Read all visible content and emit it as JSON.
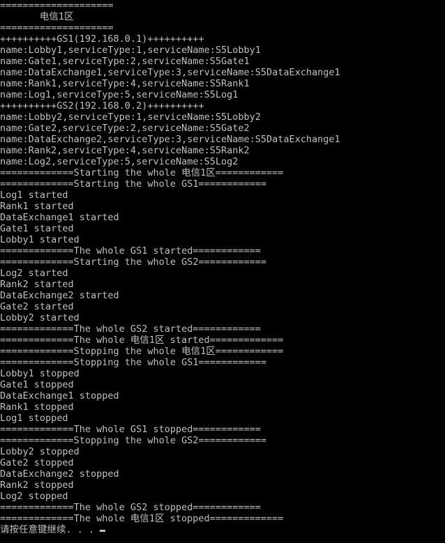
{
  "window": {
    "type": "console",
    "background_color": "#000000",
    "text_color": "#c0c0c0",
    "columns": 80,
    "rows": 48
  },
  "console": {
    "lines": [
      "====================",
      "       电信1区",
      "====================",
      "++++++++++GS1(192.168.0.1)++++++++++",
      "name:Lobby1,serviceType:1,serviceName:S5Lobby1",
      "name:Gate1,serviceType:2,serviceName:S5Gate1",
      "name:DataExchange1,serviceType:3,serviceName:S5DataExchange1",
      "name:Rank1,serviceType:4,serviceName:S5Rank1",
      "name:Log1,serviceType:5,serviceName:S5Log1",
      "++++++++++GS2(192.168.0.2)++++++++++",
      "name:Lobby2,serviceType:1,serviceName:S5Lobby2",
      "name:Gate2,serviceType:2,serviceName:S5Gate2",
      "name:DataExchange2,serviceType:3,serviceName:S5DataExchange1",
      "name:Rank2,serviceType:4,serviceName:S5Rank2",
      "name:Log2,serviceType:5,serviceName:S5Log2",
      "=============Starting the whole 电信1区============",
      "=============Starting the whole GS1============",
      "Log1 started",
      "Rank1 started",
      "DataExchange1 started",
      "Gate1 started",
      "Lobby1 started",
      "=============The whole GS1 started============",
      "=============Starting the whole GS2============",
      "Log2 started",
      "Rank2 started",
      "DataExchange2 started",
      "Gate2 started",
      "Lobby2 started",
      "=============The whole GS2 started============",
      "=============The whole 电信1区 started=============",
      "=============Stopping the whole 电信1区============",
      "=============Stopping the whole GS1============",
      "Lobby1 stopped",
      "Gate1 stopped",
      "DataExchange1 stopped",
      "Rank1 stopped",
      "Log1 stopped",
      "=============The whole GS1 stopped============",
      "=============Stopping the whole GS2============",
      "Lobby2 stopped",
      "Gate2 stopped",
      "DataExchange2 stopped",
      "Rank2 stopped",
      "Log2 stopped",
      "=============The whole GS2 stopped============",
      "=============The whole 电信1区 stopped============="
    ],
    "prompt_line": "请按任意键继续. . .",
    "cursor_visible": true
  }
}
